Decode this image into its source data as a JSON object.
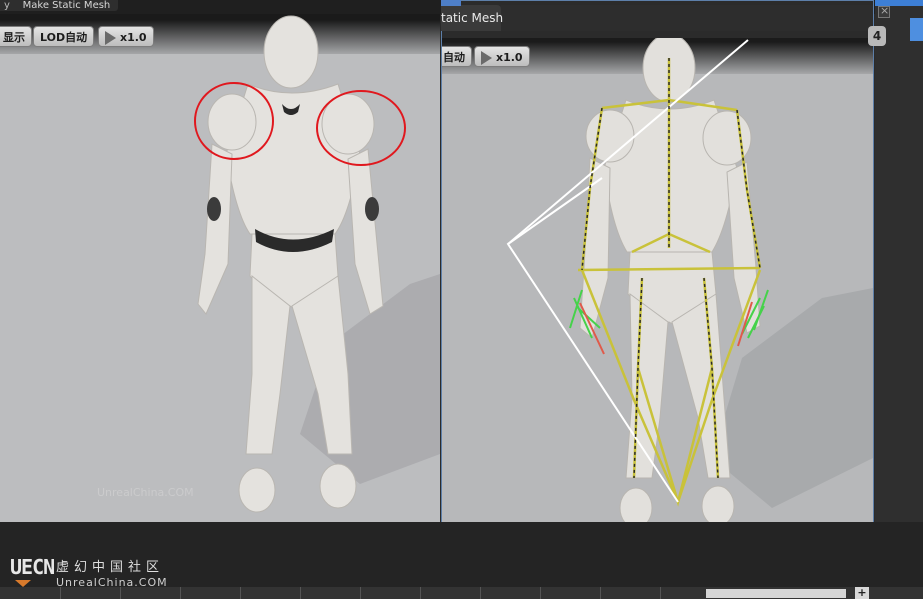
{
  "left_panel": {
    "tab_title": "Make Static Mesh",
    "toolbar": {
      "show_label": "显示",
      "lod_label": "LOD自动",
      "speed_label": "x1.0"
    },
    "watermark": "UnrealChina.COM"
  },
  "right_panel": {
    "tab_title": "tatic Mesh",
    "toolbar": {
      "lod_label": "自动",
      "speed_label": "x1.0"
    },
    "side_badge": "4"
  },
  "footer": {
    "logo_mark": "UECN",
    "logo_cn": "虚幻中国社区",
    "logo_en": "UnrealChina.COM",
    "plus_label": "+"
  },
  "colors": {
    "viewport_bg": "#bcbdbf",
    "highlight_circle": "#e0181e",
    "skeleton_bone": "#c9c23a",
    "selection_border": "#5d7fa9"
  }
}
